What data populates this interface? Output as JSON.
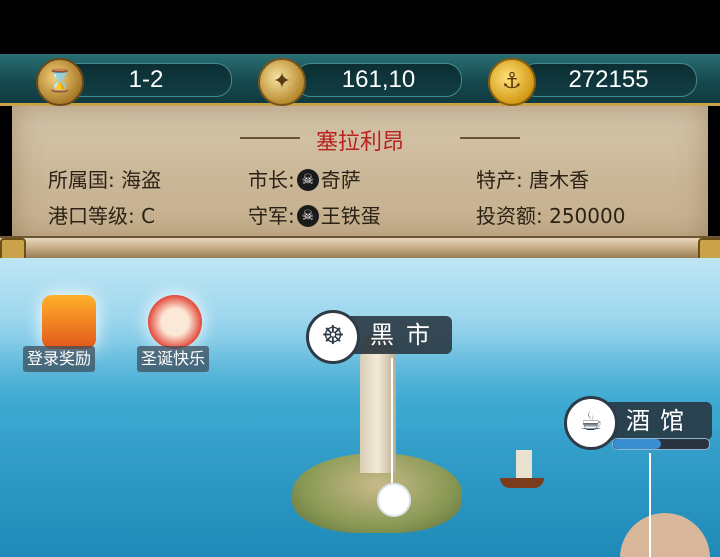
{
  "hud": {
    "turn": "1-2",
    "coordinates": "161,10",
    "gold": "272155",
    "icons": [
      "hourglass-icon",
      "compass-icon",
      "anchor-coin-icon"
    ]
  },
  "city": {
    "name": "塞拉利昂",
    "affiliation": "所属国: 海盗",
    "mayor_prefix": "市长:",
    "mayor_name": "奇萨",
    "specialty": "特产: 唐木香",
    "port_level": "港口等级: C",
    "garrison_prefix": "守军:",
    "garrison_name": "王铁蛋",
    "investment": "投资额: 250000"
  },
  "events": {
    "login_reward": "登录奖励",
    "christmas": "圣诞快乐"
  },
  "markers": {
    "black_market": "黑市",
    "tavern": "酒馆",
    "tavern_progress": 0.5
  },
  "colors": {
    "city_name": "#b8231f",
    "hud_bg": "#164a4f"
  }
}
